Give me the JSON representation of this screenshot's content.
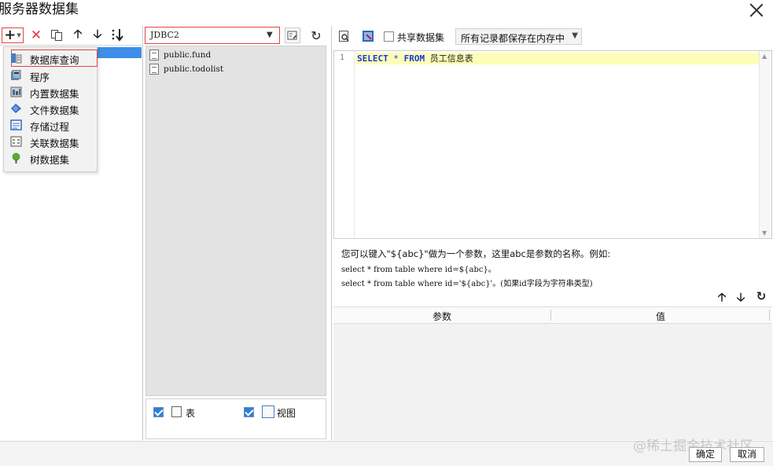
{
  "window": {
    "title": "服务器数据集"
  },
  "left_toolbar": {
    "add_icon": "plus-icon",
    "delete_icon": "delete-icon",
    "copy_icon": "copy-icon",
    "up_icon": "arrow-up-icon",
    "down_icon": "arrow-down-icon",
    "sort_icon": "sort-icon"
  },
  "add_menu": {
    "items": [
      {
        "label": "数据库查询",
        "icon": "db-query-icon"
      },
      {
        "label": "程序",
        "icon": "program-icon"
      },
      {
        "label": "内置数据集",
        "icon": "builtin-dataset-icon"
      },
      {
        "label": "文件数据集",
        "icon": "file-dataset-icon"
      },
      {
        "label": "存储过程",
        "icon": "stored-procedure-icon"
      },
      {
        "label": "关联数据集",
        "icon": "relation-dataset-icon"
      },
      {
        "label": "树数据集",
        "icon": "tree-dataset-icon"
      }
    ]
  },
  "connection": {
    "selected": "JDBC2"
  },
  "tables": [
    {
      "name": "public.fund"
    },
    {
      "name": "public.todolist"
    }
  ],
  "filters": {
    "table_label": "表",
    "view_label": "视图"
  },
  "right_toolbar": {
    "share_label": "共享数据集",
    "memory_option": "所有记录都保存在内存中"
  },
  "editor": {
    "line_number": "1",
    "kw_select": "SELECT",
    "star": "*",
    "kw_from": "FROM",
    "table": "员工信息表"
  },
  "help": {
    "line1": "您可以键入\"${abc}\"做为一个参数，这里abc是参数的名称。例如:",
    "line2": "select * from table where id=${abc}。",
    "line3": "select * from table where id='${abc}'。(如果id字段为字符串类型)"
  },
  "params_table": {
    "col_param": "参数",
    "col_value": "值"
  },
  "footer": {
    "ok_label": "确定",
    "cancel_label": "取消",
    "watermark": "@稀土掘金技术社区"
  },
  "colors": {
    "accent_red": "#e04545",
    "selection_blue": "#3d8ee8",
    "keyword_blue": "#1a37d8",
    "highlight_yellow": "#fdfdb8"
  }
}
